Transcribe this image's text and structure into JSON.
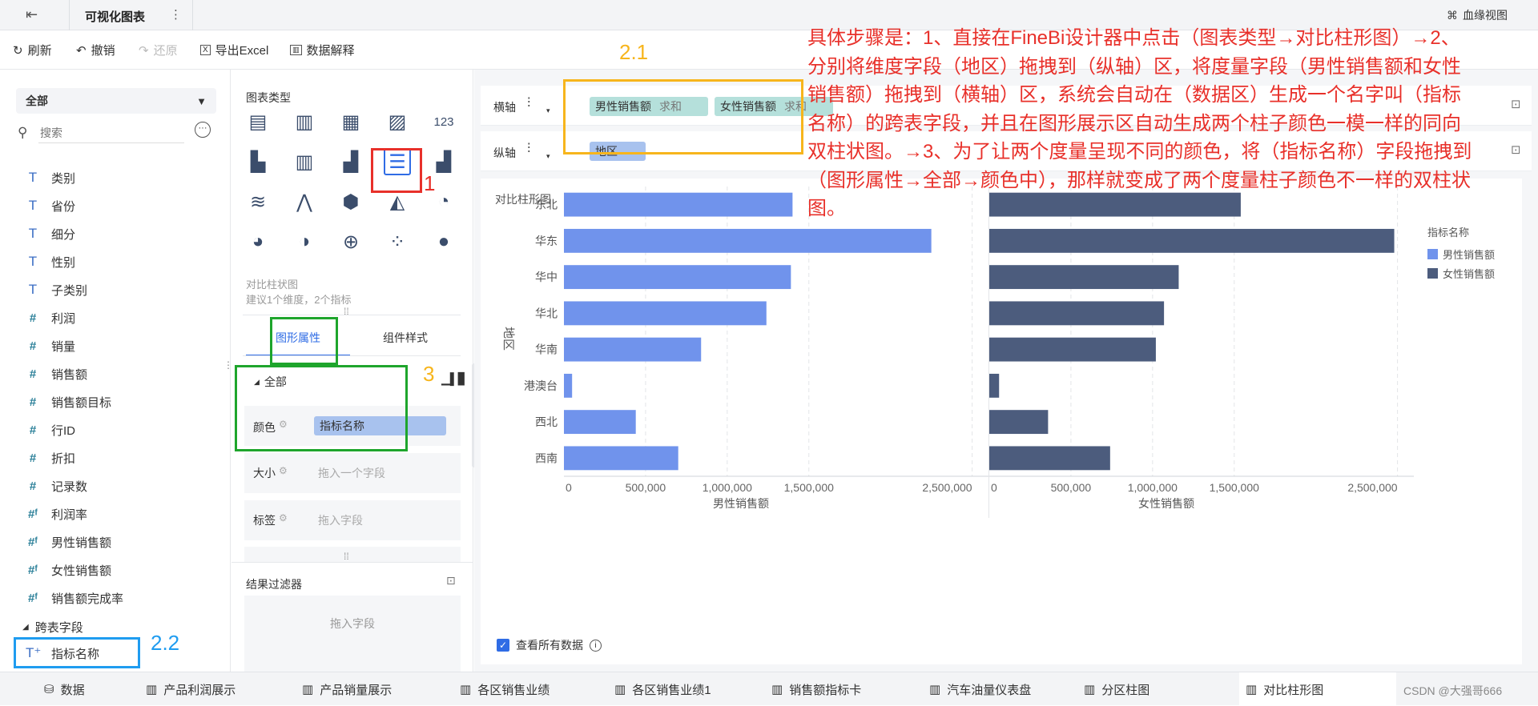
{
  "topbar": {
    "title": "可视化图表",
    "more": "⋮",
    "lineage": "血缘视图"
  },
  "toolbar": {
    "refresh": "刷新",
    "undo": "撤销",
    "redo": "还原",
    "export": "导出Excel",
    "explain": "数据解释"
  },
  "left": {
    "dataset": "全部",
    "search_placeholder": "搜索",
    "fields": [
      {
        "kind": "dim",
        "label": "类别"
      },
      {
        "kind": "dim",
        "label": "省份"
      },
      {
        "kind": "dim",
        "label": "细分"
      },
      {
        "kind": "dim",
        "label": "性别"
      },
      {
        "kind": "dim",
        "label": "子类别"
      },
      {
        "kind": "mea",
        "label": "利润"
      },
      {
        "kind": "mea",
        "label": "销量"
      },
      {
        "kind": "mea",
        "label": "销售额"
      },
      {
        "kind": "mea",
        "label": "销售额目标"
      },
      {
        "kind": "mea",
        "label": "行ID"
      },
      {
        "kind": "mea",
        "label": "折扣"
      },
      {
        "kind": "mea",
        "label": "记录数"
      },
      {
        "kind": "calc",
        "label": "利润率"
      },
      {
        "kind": "calc",
        "label": "男性销售额"
      },
      {
        "kind": "calc",
        "label": "女性销售额"
      },
      {
        "kind": "calc",
        "label": "销售额完成率"
      }
    ],
    "cross_section": "跨表字段",
    "cross_field": "指标名称"
  },
  "mid": {
    "chart_types_title": "图表类型",
    "selected_name": "对比柱状图",
    "selected_hint": "建议1个维度，2个指标",
    "tab_props": "图形属性",
    "tab_style": "组件样式",
    "group_all": "全部",
    "color_label": "颜色",
    "color_field": "指标名称",
    "size_label": "大小",
    "size_placeholder": "拖入一个字段",
    "label_label": "标签",
    "label_placeholder": "拖入字段",
    "filter_title": "结果过滤器",
    "filter_placeholder": "拖入字段"
  },
  "axes": {
    "x_label": "横轴",
    "y_label": "纵轴",
    "x_fields": [
      {
        "name": "男性销售额",
        "agg": "求和"
      },
      {
        "name": "女性销售额",
        "agg": "求和"
      }
    ],
    "y_field": "地区"
  },
  "card": {
    "title": "对比柱形图",
    "show_all": "查看所有数据"
  },
  "chart_data": {
    "type": "bar",
    "orientation": "horizontal-mirrored",
    "categories": [
      "东北",
      "华东",
      "华中",
      "华北",
      "华南",
      "港澳台",
      "西北",
      "西南"
    ],
    "ylabel": "地区",
    "legend_title": "指标名称",
    "legend_position": "right",
    "series": [
      {
        "name": "男性销售额",
        "color": "#7093ec",
        "values": [
          1400000,
          2250000,
          1390000,
          1240000,
          840000,
          50000,
          440000,
          700000
        ],
        "xlabel": "男性销售额",
        "ticks": [
          "0",
          "500,000",
          "1,000,000",
          "1,500,000",
          "2,500,000"
        ],
        "xlim": [
          0,
          2600000
        ]
      },
      {
        "name": "女性销售额",
        "color": "#4c5c7d",
        "values": [
          1540000,
          2480000,
          1160000,
          1070000,
          1020000,
          60000,
          360000,
          740000
        ],
        "xlabel": "女性销售额",
        "ticks": [
          "0",
          "500,000",
          "1,000,000",
          "1,500,000",
          "2,500,000"
        ],
        "xlim": [
          0,
          2600000
        ]
      }
    ]
  },
  "annotation": {
    "text": "具体步骤是：1、直接在FineBi设计器中点击（图表类型→对比柱形图）→2、分别将维度字段（地区）拖拽到（纵轴）区，将度量字段（男性销售额和女性销售额）拖拽到（横轴）区，系统会自动在（数据区）生成一个名字叫（指标名称）的跨表字段，并且在图形展示区自动生成两个柱子颜色一模一样的同向双柱状图。→3、为了让两个度量呈现不同的颜色，将（指标名称）字段拖拽到（图形属性→全部→颜色中），那样就变成了两个度量柱子颜色不一样的双柱状图。",
    "n1": "1",
    "n21": "2.1",
    "n22": "2.2",
    "n3": "3",
    "red": "#e8302a",
    "orange": "#f7b51c",
    "green": "#1ea52c",
    "blue": "#1f9cf0"
  },
  "tabs": [
    "数据",
    "产品利润展示",
    "产品销量展示",
    "各区销售业绩",
    "各区销售业绩1",
    "销售额指标卡",
    "汽车油量仪表盘",
    "分区柱图",
    "对比柱形图"
  ],
  "watermark": "CSDN @大强哥666"
}
